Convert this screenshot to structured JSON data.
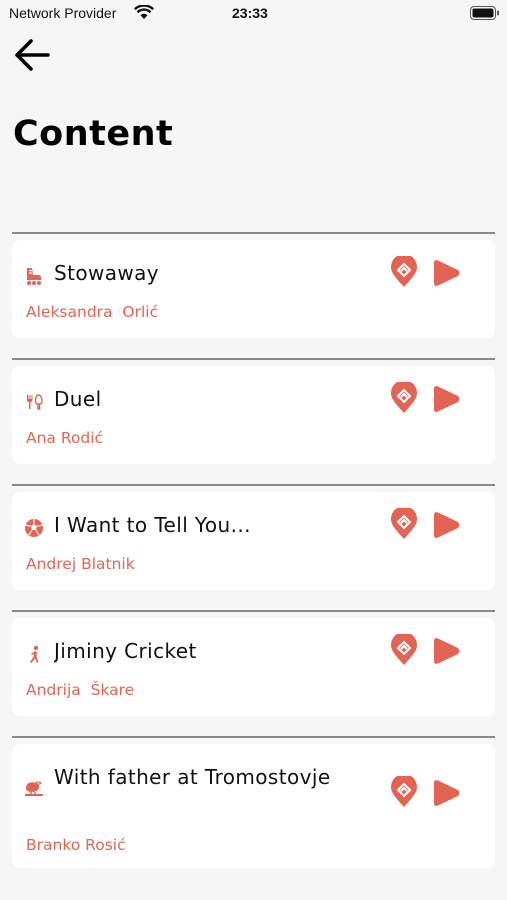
{
  "status": {
    "carrier": "Network Provider",
    "time": "23:33"
  },
  "header": {
    "title": "Content"
  },
  "colors": {
    "accent": "#e36454"
  },
  "items": [
    {
      "title": "Stowaway",
      "author": "Aleksandra  Orlić",
      "icon": "rollerblade-icon"
    },
    {
      "title": "Duel",
      "author": "Ana Rodić",
      "icon": "fork-knife-icon"
    },
    {
      "title": "I Want to Tell You...",
      "author": "Andrej Blatnik",
      "icon": "soccer-ball-icon"
    },
    {
      "title": "Jiminy Cricket",
      "author": "Andrija  Škare",
      "icon": "person-icon"
    },
    {
      "title": "With father at Tromostovje",
      "author": "Branko Rosić",
      "icon": "bird-icon"
    }
  ]
}
